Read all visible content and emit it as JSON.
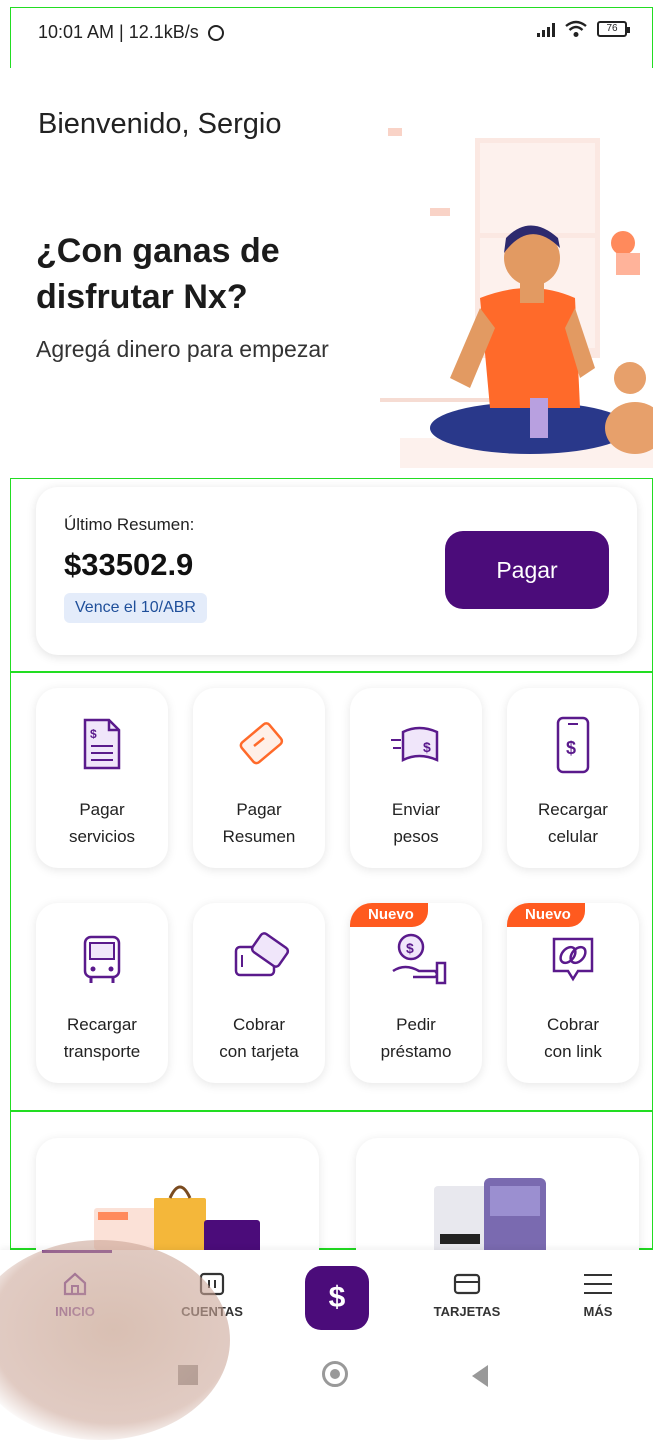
{
  "status_bar": {
    "time": "10:01 AM | 12.1kB/s",
    "battery": "76"
  },
  "hero": {
    "welcome": "Bienvenido, Sergio",
    "title": "¿Con ganas de disfrutar Nx?",
    "subtitle": "Agregá dinero para empezar"
  },
  "summary": {
    "label": "Último Resumen:",
    "amount": "$33502.9",
    "due": "Vence el 10/ABR",
    "pay_button": "Pagar"
  },
  "actions": [
    {
      "line1": "Pagar",
      "line2": "servicios",
      "icon": "bill-icon"
    },
    {
      "line1": "Pagar",
      "line2": "Resumen",
      "icon": "card-icon"
    },
    {
      "line1": "Enviar",
      "line2": "pesos",
      "icon": "money-fly-icon"
    },
    {
      "line1": "Recargar",
      "line2": "celular",
      "icon": "phone-dollar-icon"
    },
    {
      "line1": "Recargar",
      "line2": "transporte",
      "icon": "bus-icon"
    },
    {
      "line1": "Cobrar",
      "line2": "con tarjeta",
      "icon": "card-reader-icon"
    },
    {
      "line1": "Pedir",
      "line2": "préstamo",
      "icon": "loan-hand-icon",
      "badge": "Nuevo"
    },
    {
      "line1": "Cobrar",
      "line2": "con link",
      "icon": "link-icon",
      "badge": "Nuevo"
    }
  ],
  "bottom_nav": {
    "inicio": "INICIO",
    "cuentas": "CUENTAS",
    "center": "$",
    "tarjetas": "TARJETAS",
    "mas": "MÁS"
  },
  "colors": {
    "primary": "#4b0c7a",
    "accent": "#ff5a1f",
    "badge_bg": "#e4ecfa"
  }
}
